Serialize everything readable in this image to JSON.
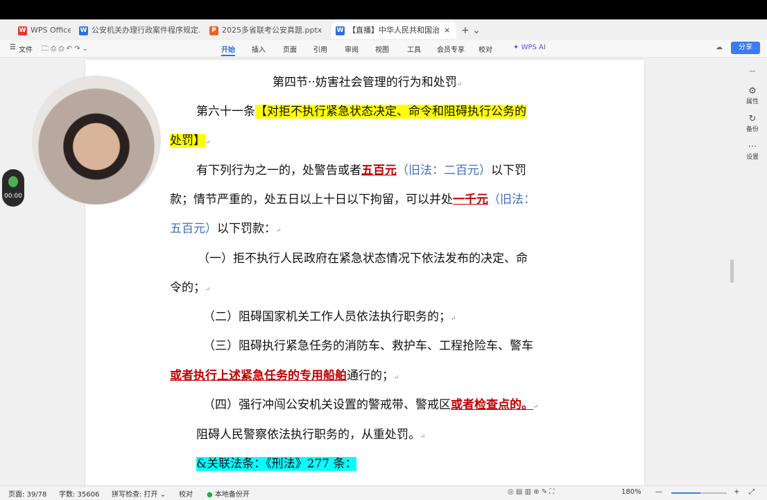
{
  "tabs": [
    {
      "label": "WPS Office",
      "icon": "wps-logo-icon"
    },
    {
      "label": "公安机关办理行政案件程序规定.do",
      "icon": "word-doc-icon"
    },
    {
      "label": "2025多省联考公安真题.pptx",
      "icon": "ppt-doc-icon"
    },
    {
      "label": "【直播】中华人民共和国治",
      "icon": "word-doc-icon"
    }
  ],
  "toolbar": {
    "file": "文件",
    "menu": [
      "开始",
      "插入",
      "页面",
      "引用",
      "审阅",
      "视图",
      "工具",
      "会员专享",
      "校对"
    ],
    "ai": "WPS AI",
    "share": "分享"
  },
  "document": {
    "section_title": "第四节··妨害社会管理的行为和处罚",
    "article_prefix": "第六十一条",
    "article_title_part1": "【对拒不执行紧急状态决定、命令和阻碍执行公务的",
    "article_title_part2": "处罚】",
    "p1_a": "有下列行为之一的，处警告或者",
    "p1_new1": "五百元",
    "p1_old1": "（旧法：二百元）",
    "p1_b": "以下罚",
    "p2_a": "款；情节严重的，处五日以上十日以下拘留，可以并处",
    "p2_new2": "一千元",
    "p2_old2a": "（旧法：",
    "p3_old2b": "五百元）",
    "p3_a": "以下罚款：",
    "item1_a": "（一）拒不执行人民政府在紧急状态情况下依法发布的决定、命",
    "item1_b": "令的；",
    "item2": "（二）阻碍国家机关工作人员依法执行职务的；",
    "item3_a": "（三）阻碍执行紧急任务的消防车、救护车、工程抢险车、警车",
    "item3_b_red": "或者执行上述紧急任务的专用船舶",
    "item3_b": "通行的；",
    "item4_a": "（四）强行冲闯公安机关设置的警戒带、警戒区",
    "item4_red": "或者检查点的。",
    "p_last": "阻碍人民警察依法执行职务的，从重处罚。",
    "related": "&关联法条：《刑法》277 条：",
    "para_mark": "↵"
  },
  "right_panel": [
    "属性",
    "备份",
    "设置"
  ],
  "statusbar": {
    "page": "页面: 39/78",
    "words": "字数: 35606",
    "spell": "拼写检查: 打开",
    "proof": "校对",
    "backup": "本地备份开",
    "zoom": "180%"
  },
  "timer": "00:00"
}
